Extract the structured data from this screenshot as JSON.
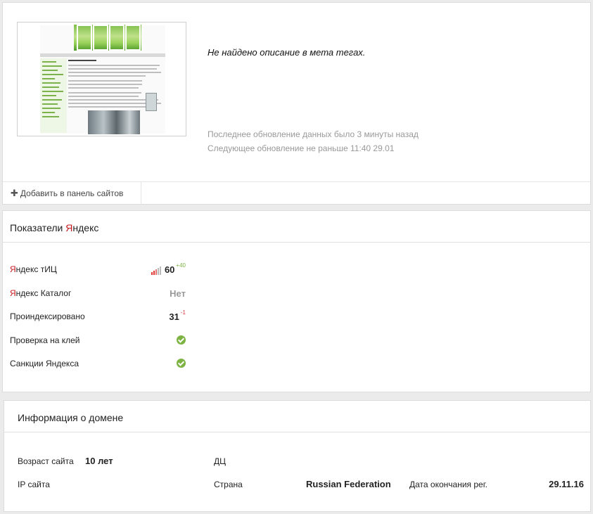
{
  "site": {
    "description": "Не найдено описание в мета тегах.",
    "last_update": "Последнее обновление данных было 3 минуты назад",
    "next_update": "Следующее обновление не раньше 11:40 29.01",
    "add_button": "Добавить в панель сайтов"
  },
  "yandex": {
    "title_prefix": "Показатели ",
    "title_brand_first": "Я",
    "title_brand_rest": "ндекс",
    "rows": [
      {
        "label_first": "Я",
        "label_rest": "ндекс тИЦ",
        "value": "60",
        "delta": "+40"
      },
      {
        "label_first": "Я",
        "label_rest": "ндекс Каталог",
        "value": "Нет"
      },
      {
        "label": "Проиндексировано",
        "value": "31",
        "delta": "-1"
      },
      {
        "label": "Проверка на клей",
        "icon": "check-icon"
      },
      {
        "label": "Санкции Яндекса",
        "icon": "check-icon"
      }
    ]
  },
  "domain": {
    "title": "Информация о домене",
    "age_label": "Возраст сайта",
    "age_value": "10 лет",
    "dc_label": "ДЦ",
    "ip_label": "IP сайта",
    "country_label": "Страна",
    "country_value": "Russian Federation",
    "expiry_label": "Дата окончания рег.",
    "expiry_value": "29.11.16"
  },
  "colors": {
    "accent_red": "#c4161c",
    "positive": "#7cb342",
    "negative": "#d9363e"
  }
}
